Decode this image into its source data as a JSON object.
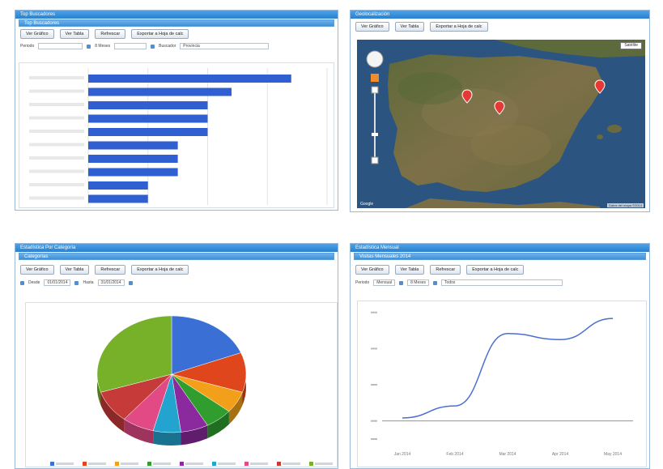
{
  "panels": {
    "bar_panel": {
      "title": "Top Buscadores",
      "subtitle": "Top Buscadores",
      "buttons": [
        "Ver Gráfico",
        "Ver Tabla",
        "Refrescar",
        "Exportar a Hoja de calc"
      ],
      "filters": {
        "label": "Periodo",
        "from": "8 Meses",
        "to": "Buscador",
        "extra": "Provincia"
      }
    },
    "map_panel": {
      "title": "Geolocalización",
      "buttons": [
        "Ver Gráfico",
        "Ver Tabla",
        "Exportar a Hoja de calc"
      ],
      "map_type_label": "Satélite",
      "footer_left": "Google",
      "footer_right": "Datos del mapa ©2014"
    },
    "pie_panel": {
      "title": "Estadística Por Categoría",
      "subtitle": "Categorías",
      "buttons": [
        "Ver Gráfico",
        "Ver Tabla",
        "Refrescar",
        "Exportar a Hoja de calc"
      ],
      "filters": {
        "label": "Desde",
        "from": "01/01/2014",
        "to_label": "Hasta",
        "to": "31/01/2014"
      }
    },
    "line_panel": {
      "title": "Estadística Mensual",
      "subtitle": "Visitas Mensuales 2014",
      "buttons": [
        "Ver Gráfico",
        "Ver Tabla",
        "Refrescar",
        "Exportar a Hoja de calc"
      ],
      "filters": {
        "label": "Periodo",
        "from": "Mensual",
        "to": "8 Meses",
        "extra": "Todos"
      }
    }
  },
  "chart_data": [
    {
      "type": "bar",
      "orientation": "horizontal",
      "categories": [
        "",
        "",
        "",
        "",
        "",
        "",
        "",
        "",
        "",
        ""
      ],
      "values": [
        34,
        24,
        20,
        20,
        20,
        15,
        15,
        15,
        10,
        10
      ],
      "xlim": [
        0,
        40
      ],
      "grid": true,
      "color": "#2f5fd0"
    },
    {
      "type": "pie",
      "values": [
        19,
        11,
        6,
        6,
        6,
        6,
        7,
        9,
        30
      ],
      "colors": [
        "#3a6fd6",
        "#e0461c",
        "#f2a01a",
        "#2f9e2f",
        "#8a2a9e",
        "#23a4cf",
        "#e24a86",
        "#c73a3a",
        "#77b12a"
      ],
      "labels": [
        "",
        "",
        "",
        "",
        "",
        "",
        "",
        "",
        ""
      ],
      "legend_position": "bottom"
    },
    {
      "type": "line",
      "x": [
        "Jan 2014",
        "Feb 2014",
        "Mar 2014",
        "Apr 2014",
        "May 2014"
      ],
      "y": [
        1,
        5,
        29,
        27,
        34
      ],
      "ylim": [
        -6,
        37
      ],
      "grid": false,
      "color": "#4a6fd0"
    }
  ],
  "map": {
    "markers": [
      "marker-1",
      "marker-2",
      "marker-3"
    ],
    "water_color": "#2d5a86",
    "land_color": "#6e6b45"
  }
}
